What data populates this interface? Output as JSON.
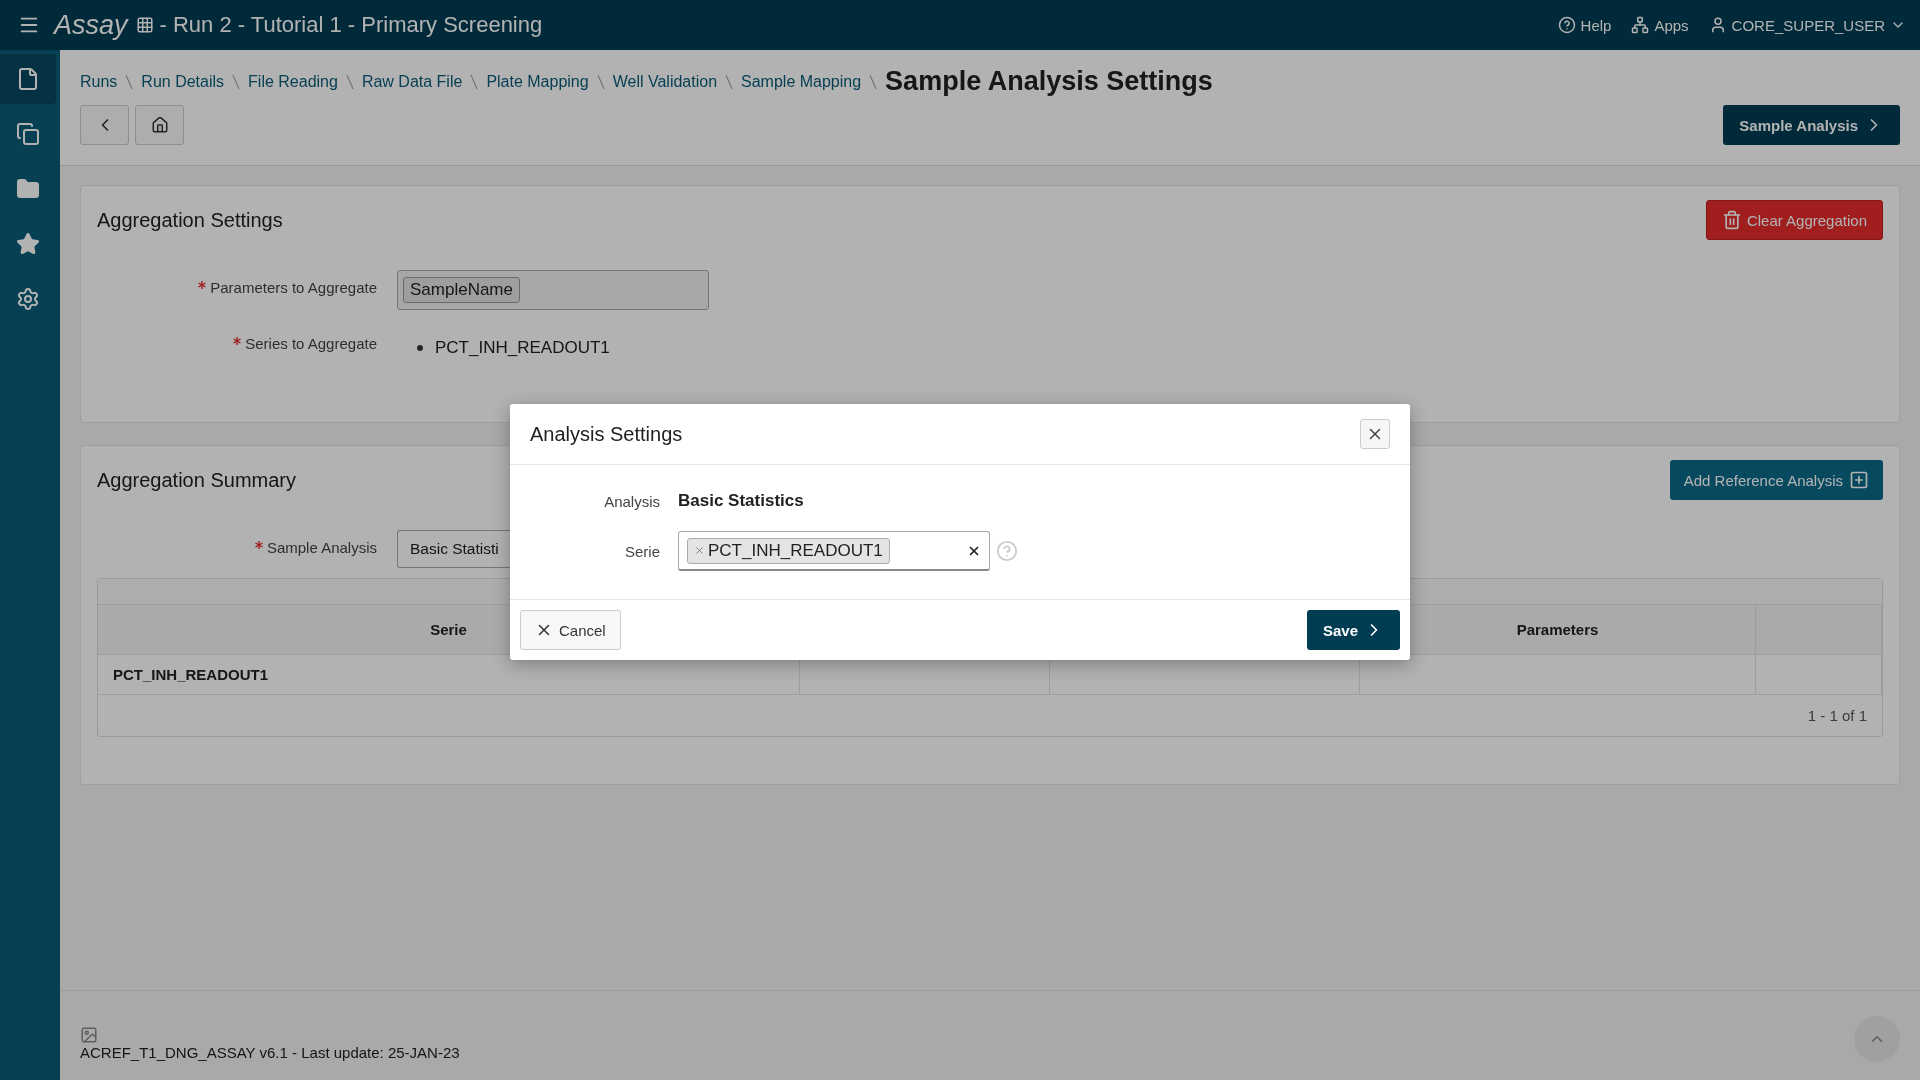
{
  "app": {
    "name": "Assay",
    "title": "- Run 2 - Tutorial 1 - Primary Screening"
  },
  "top_nav": [
    {
      "kind": "help",
      "label": "Help"
    },
    {
      "kind": "apps",
      "label": "Apps"
    },
    {
      "kind": "user",
      "label": "CORE_SUPER_USER"
    }
  ],
  "sidebar": {
    "items": [
      {
        "kind": "file",
        "selected": true
      },
      {
        "kind": "copy",
        "selected": false
      },
      {
        "kind": "folder",
        "selected": false
      },
      {
        "kind": "star",
        "selected": false
      },
      {
        "kind": "gear",
        "selected": false
      }
    ]
  },
  "breadcrumbs": [
    "Runs",
    "Run Details",
    "File Reading",
    "Raw Data File",
    "Plate Mapping",
    "Well Validation",
    "Sample Mapping"
  ],
  "page_title": "Sample Analysis Settings",
  "next_button": "Sample Analysis",
  "aggregation_settings": {
    "title": "Aggregation Settings",
    "clear_button": "Clear Aggregation",
    "parameters_label": "Parameters to Aggregate",
    "parameters_required": true,
    "parameters": [
      "SampleName"
    ],
    "series_label": "Series to Aggregate",
    "series_required": true,
    "series": [
      "PCT_INH_READOUT1"
    ]
  },
  "aggregation_summary": {
    "title": "Aggregation Summary",
    "add_button": "Add Reference Analysis",
    "sample_analysis_label": "Sample Analysis",
    "sample_analysis_required": true,
    "sample_analysis_value": "Basic Statisti",
    "table": {
      "columns": [
        {
          "label": "Serie"
        },
        {},
        {},
        {
          "label": "Parameters"
        },
        {}
      ],
      "rows": [
        {
          "cells": [
            "PCT_INH_READOUT1"
          ]
        }
      ],
      "pagination": "1 - 1 of 1"
    }
  },
  "footer": {
    "text": "ACREF_T1_DNG_ASSAY v6.1 - Last update: 25-JAN-23"
  },
  "dialog": {
    "title": "Analysis Settings",
    "analysis_label": "Analysis",
    "analysis_value": "Basic Statistics",
    "serie_label": "Serie",
    "serie_tags": [
      "PCT_INH_READOUT1"
    ],
    "cancel": "Cancel",
    "save": "Save"
  }
}
